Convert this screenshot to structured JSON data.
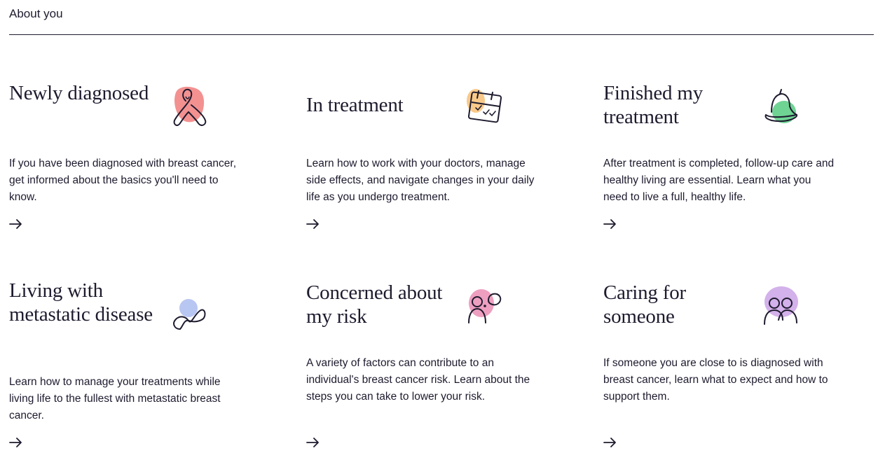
{
  "header": {
    "title": "About you"
  },
  "colors": {
    "text": "#1e1b2e",
    "coral": "#f28b8b",
    "peach": "#f9c98a",
    "green": "#6fd394",
    "blue": "#b8c6f2",
    "pink": "#ee9fc0",
    "lavender": "#d3b1ea"
  },
  "cards": [
    {
      "title": "Newly diagnosed",
      "description": "If you have been diagnosed with breast cancer, get informed about the basics you'll need to know.",
      "icon": "awareness-ribbon-icon",
      "arrow": "→"
    },
    {
      "title": "In treatment",
      "description": "Learn how to work with your doctors, manage side effects, and navigate changes in your daily life as you undergo treatment.",
      "icon": "calendar-icon",
      "arrow": "→"
    },
    {
      "title": "Finished my treatment",
      "description": "After treatment is completed, follow-up care and healthy living are essential. Learn what you need to live a full, healthy life.",
      "icon": "bell-icon",
      "arrow": "→"
    },
    {
      "title": "Living with metastatic disease",
      "description": "Learn how to manage your treatments while living life to the fullest with metastatic breast cancer.",
      "icon": "infinity-icon",
      "arrow": "→"
    },
    {
      "title": "Concerned about my risk",
      "description": "A variety of factors can contribute to an individual's breast cancer risk. Learn about the steps you can take to lower your risk.",
      "icon": "thinking-person-icon",
      "arrow": "→"
    },
    {
      "title": "Caring for someone",
      "description": "If someone you are close to is diagnosed with breast cancer, learn what to expect and how to support them.",
      "icon": "two-people-icon",
      "arrow": "→"
    }
  ]
}
